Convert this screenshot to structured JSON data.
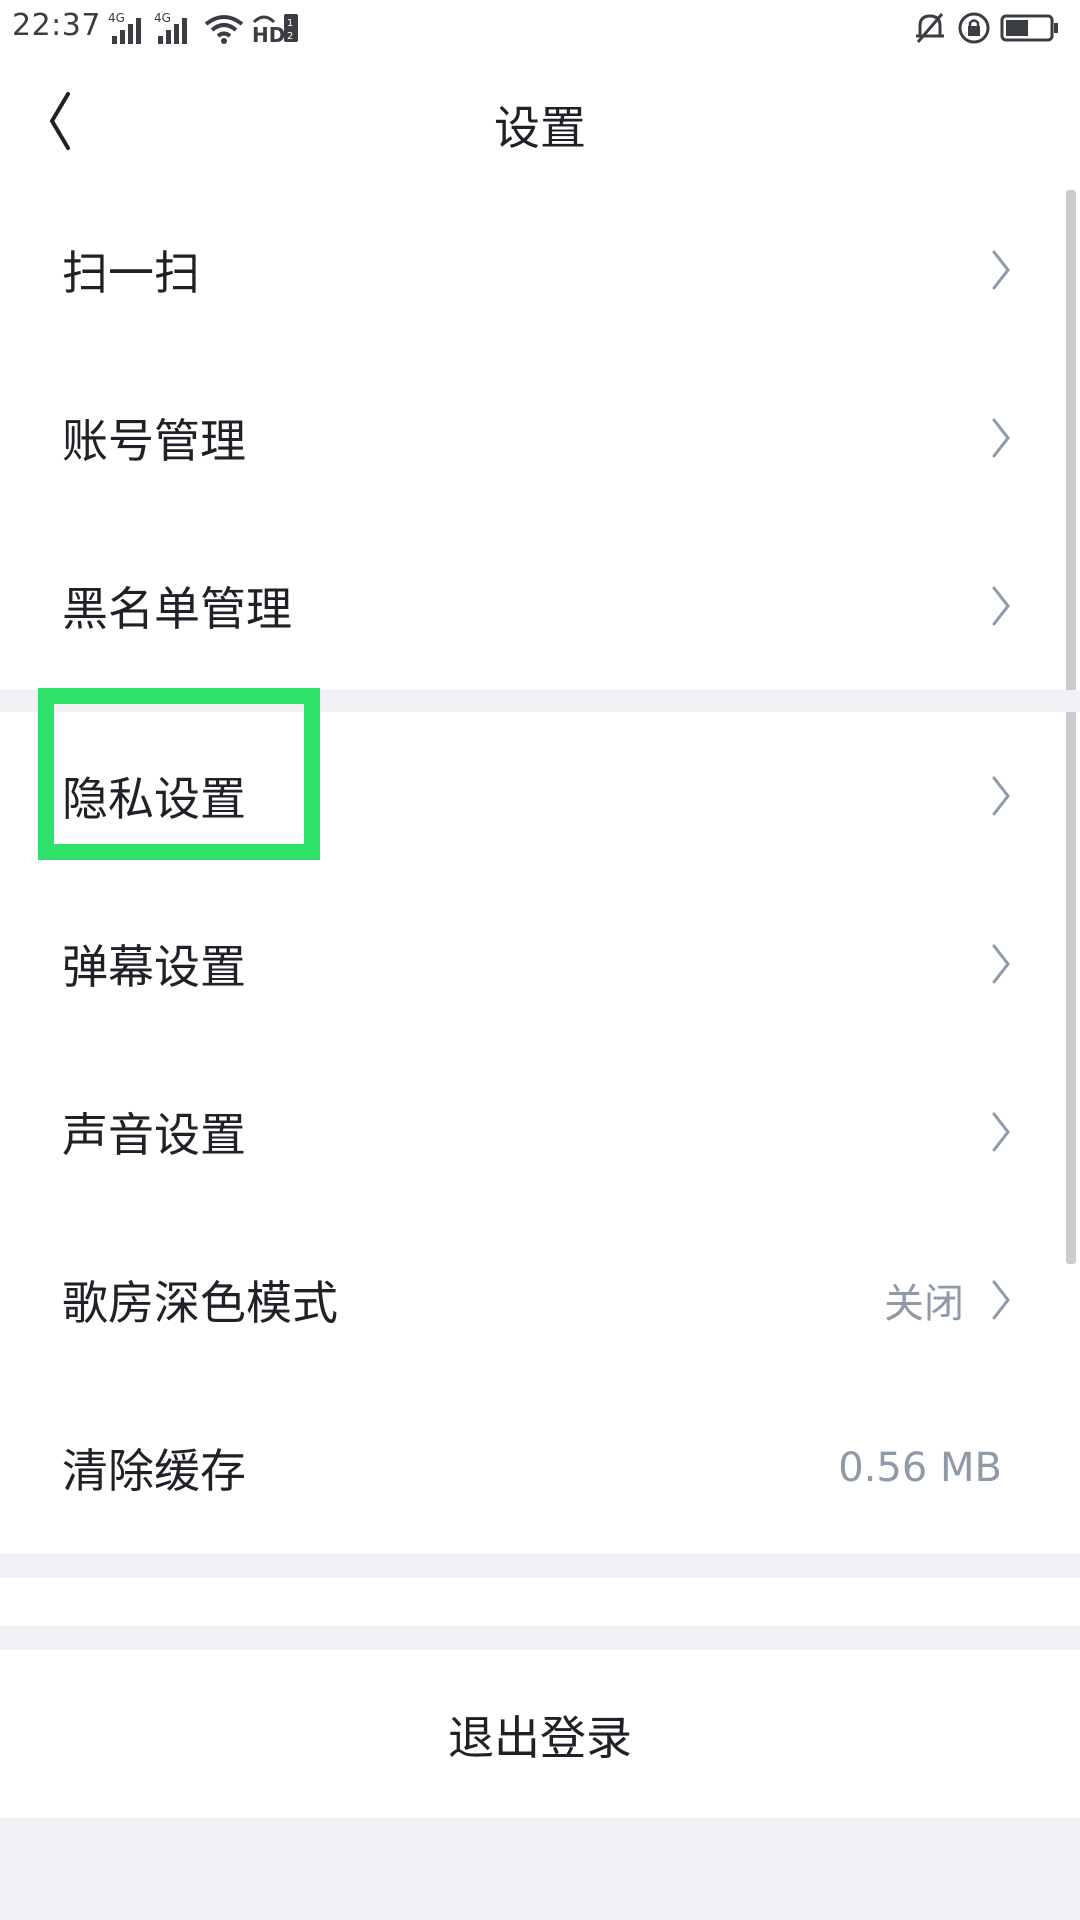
{
  "status_bar": {
    "time": "22:37",
    "left_icons": [
      "4g-signal-icon",
      "4g-signal-icon",
      "wifi-icon",
      "hd-icon"
    ],
    "right_icons": [
      "bell-muted-icon",
      "rotation-lock-icon",
      "battery-icon"
    ]
  },
  "header": {
    "title": "设置",
    "back_icon": "chevron-left-icon"
  },
  "settings_group_1": [
    {
      "label": "扫一扫"
    },
    {
      "label": "账号管理"
    },
    {
      "label": "黑名单管理"
    }
  ],
  "settings_group_2": [
    {
      "label": "隐私设置"
    },
    {
      "label": "弹幕设置"
    },
    {
      "label": "声音设置"
    },
    {
      "label": "歌房深色模式",
      "value": "关闭"
    },
    {
      "label": "清除缓存",
      "value": "0.56 MB"
    }
  ],
  "logout": {
    "label": "退出登录"
  },
  "colors": {
    "text": "#1f2126",
    "muted": "#8e9aa8",
    "band": "#f1f2f5",
    "highlight": "#2fe06a"
  }
}
